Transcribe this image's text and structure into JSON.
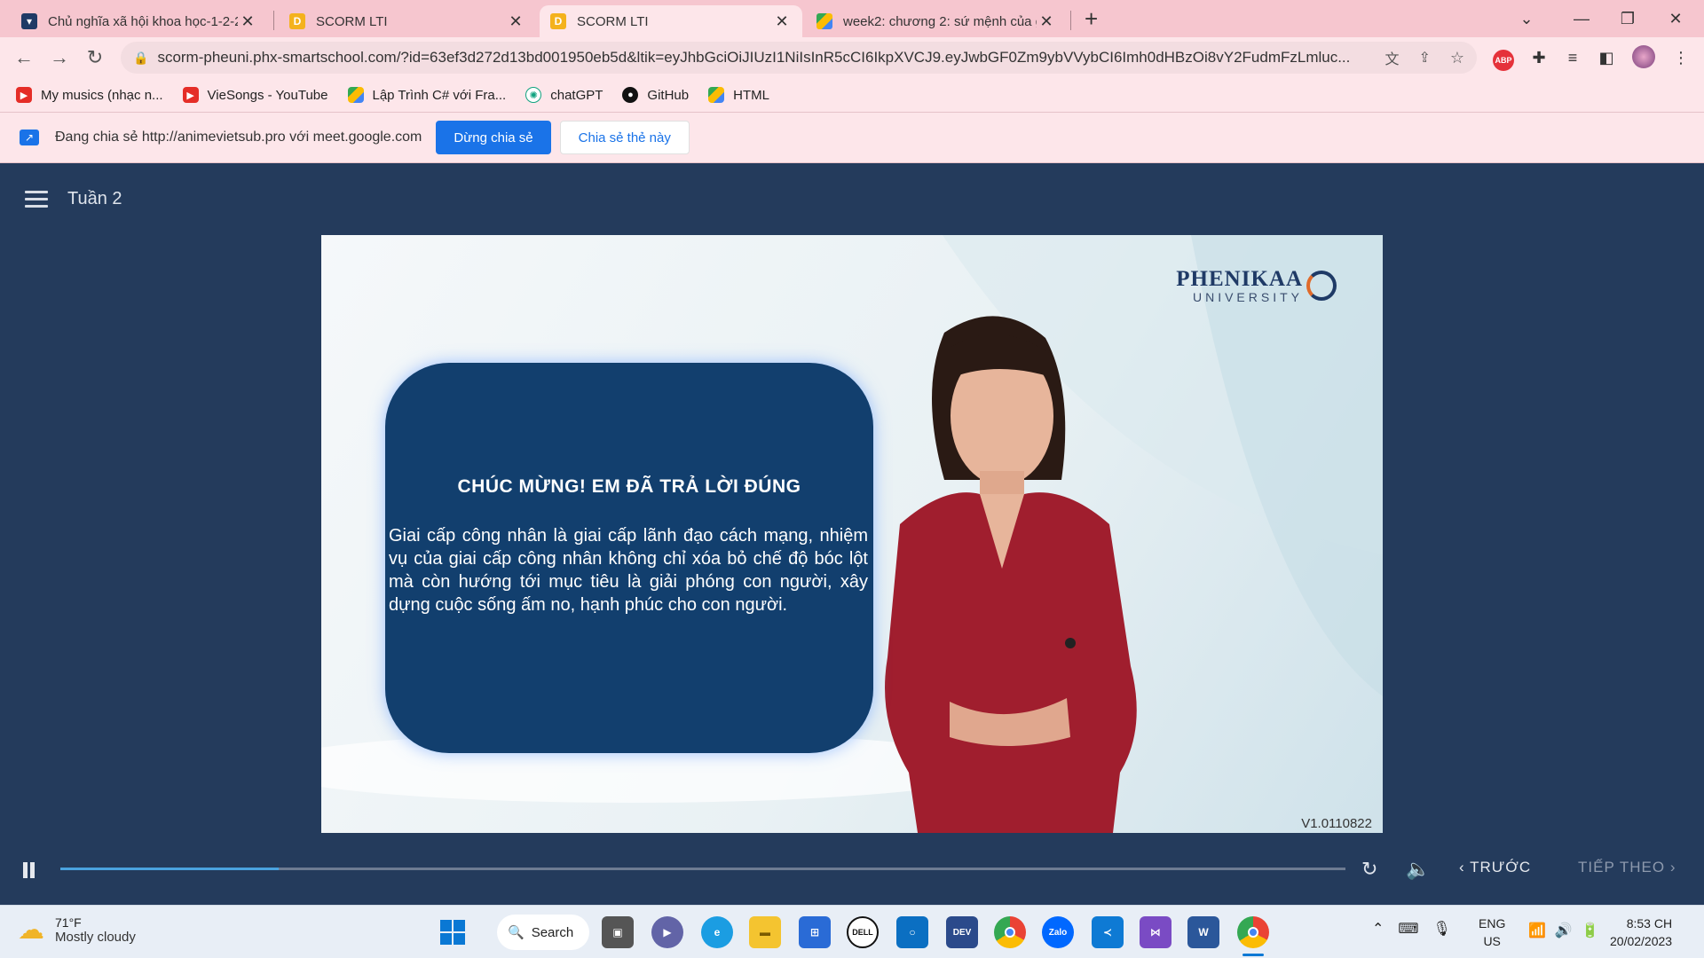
{
  "browser": {
    "tabs": [
      {
        "title": "Chủ nghĩa xã hội khoa học-1-2-2",
        "favicon": "phenikaa-favicon",
        "active": false
      },
      {
        "title": "SCORM LTI",
        "favicon": "d-favicon",
        "active": false
      },
      {
        "title": "SCORM LTI",
        "favicon": "d-favicon",
        "active": true
      },
      {
        "title": "week2: chương 2: sứ mệnh của g",
        "favicon": "google-drive-favicon",
        "active": false
      }
    ],
    "new_tab": "+",
    "url": "scorm-pheuni.phx-smartschool.com/?id=63ef3d272d13bd001950eb5d&ltik=eyJhbGciOiJIUzI1NiIsInR5cCI6IkpXVCJ9.eyJwbGF0Zm9ybVVybCI6Imh0dHBzOi8vY2FudmFzLmluc...",
    "bookmarks": [
      {
        "label": "My musics (nhạc n...",
        "icon": "youtube-icon"
      },
      {
        "label": "VieSongs - YouTube",
        "icon": "youtube-icon"
      },
      {
        "label": "Lập Trình C# với Fra...",
        "icon": "google-drive-icon"
      },
      {
        "label": "chatGPT",
        "icon": "openai-icon"
      },
      {
        "label": "GitHub",
        "icon": "github-icon"
      },
      {
        "label": "HTML",
        "icon": "google-drive-icon"
      }
    ],
    "share_bar": {
      "text": "Đang chia sẻ http://animevietsub.pro với meet.google.com",
      "stop_button": "Dừng chia sẻ",
      "share_this_button": "Chia sẻ thẻ này"
    },
    "extension_badge": "ABP"
  },
  "player": {
    "course_title": "Tuần 2",
    "card_title": "CHÚC MỪNG! EM ĐÃ TRẢ LỜI ĐÚNG",
    "card_body": "Giai cấp công nhân là giai cấp lãnh đạo cách mạng, nhiệm vụ của giai cấp công nhân không chỉ xóa bỏ chế độ bóc lột mà còn hướng tới mục tiêu là giải phóng con người, xây dựng cuộc sống ấm no, hạnh phúc cho con người.",
    "logo_line1": "PHENIKAA",
    "logo_line2": "UNIVERSITY",
    "version": "V1.0110822",
    "progress": 0.17,
    "prev_label": "TRƯỚC",
    "next_label": "TIẾP THEO"
  },
  "taskbar": {
    "weather_temp": "71°F",
    "weather_desc": "Mostly cloudy",
    "search_label": "Search",
    "language_line1": "ENG",
    "language_line2": "US",
    "time": "8:53 CH",
    "date": "20/02/2023"
  },
  "colors": {
    "tab_strip": "#f6c6cf",
    "player_bg": "#243b5c",
    "card_bg": "#123f6e",
    "progress": "#4aa3df",
    "primary_button": "#1a73e8"
  }
}
